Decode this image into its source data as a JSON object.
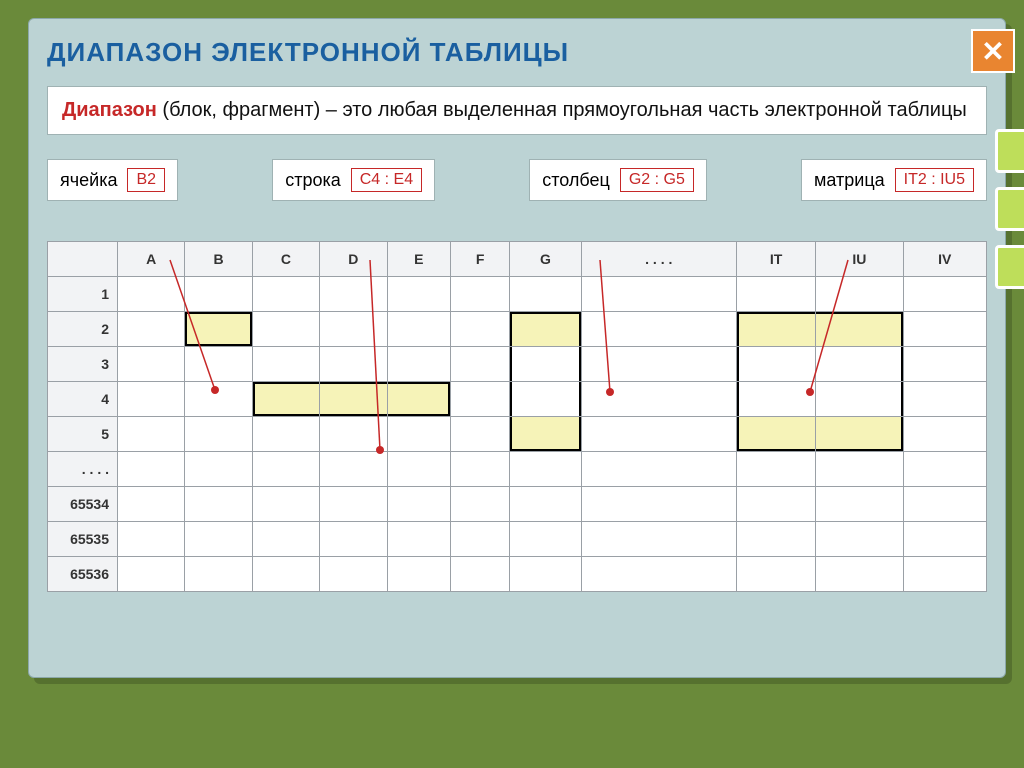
{
  "title": "ДИАПАЗОН  ЭЛЕКТРОННОЙ  ТАБЛИЦЫ",
  "definition": {
    "term": "Диапазон",
    "rest": " (блок, фрагмент) – это любая выделенная прямоугольная часть  электронной  таблицы"
  },
  "legend": {
    "cell": {
      "label": "ячейка",
      "chip": "B2"
    },
    "row": {
      "label": "строка",
      "chip": "C4 : E4"
    },
    "col": {
      "label": "столбец",
      "chip": "G2 : G5"
    },
    "matrix": {
      "label": "матрица",
      "chip": "IT2 : IU5"
    }
  },
  "columns": [
    "",
    "A",
    "B",
    "C",
    "D",
    "E",
    "F",
    "G",
    ". . . .",
    "IT",
    "IU",
    "IV"
  ],
  "rows": [
    "1",
    "2",
    "3",
    "4",
    "5",
    ". . . .",
    "65534",
    "65535",
    "65536"
  ],
  "close_label": "✕"
}
